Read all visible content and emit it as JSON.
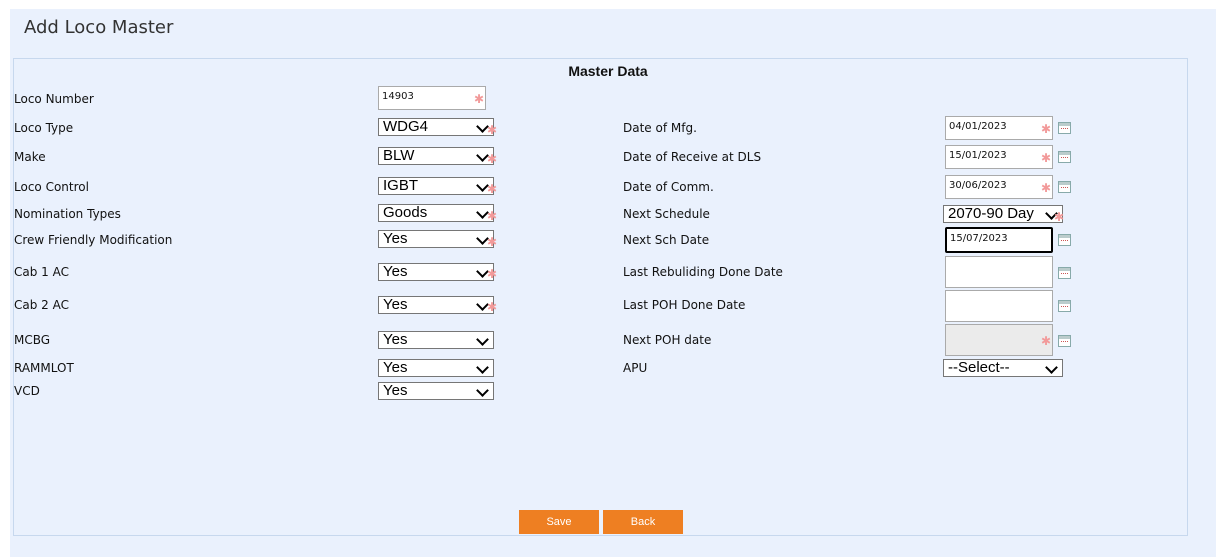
{
  "page": {
    "title": "Add Loco Master"
  },
  "panel": {
    "title": "Master Data"
  },
  "left_fields": [
    {
      "label": "Loco Number",
      "value": "14903",
      "kind": "text",
      "required": true
    },
    {
      "label": "Loco Type",
      "value": "WDG4",
      "kind": "select",
      "required": true
    },
    {
      "label": "Make",
      "value": "BLW",
      "kind": "select",
      "required": true
    },
    {
      "label": "Loco Control",
      "value": "IGBT",
      "kind": "select",
      "required": true
    },
    {
      "label": "Nomination Types",
      "value": "Goods",
      "kind": "select",
      "required": true
    },
    {
      "label": "Crew Friendly Modification",
      "value": "Yes",
      "kind": "select",
      "required": true
    },
    {
      "label": "Cab 1 AC",
      "value": "Yes",
      "kind": "select",
      "required": true
    },
    {
      "label": "Cab 2 AC",
      "value": "Yes",
      "kind": "select",
      "required": true
    },
    {
      "label": "MCBG",
      "value": "Yes",
      "kind": "select",
      "required": false
    },
    {
      "label": "RAMMLOT",
      "value": "Yes",
      "kind": "select",
      "required": false
    },
    {
      "label": "VCD",
      "value": "Yes",
      "kind": "select",
      "required": false
    }
  ],
  "right_fields": [
    {
      "label": "Date of Mfg.",
      "value": "04/01/2023",
      "kind": "date",
      "required": true
    },
    {
      "label": "Date of Receive at DLS",
      "value": "15/01/2023",
      "kind": "date",
      "required": true
    },
    {
      "label": "Date of Comm.",
      "value": "30/06/2023",
      "kind": "date",
      "required": true
    },
    {
      "label": "Next Schedule",
      "value": "2070-90 Day",
      "kind": "select",
      "required": true
    },
    {
      "label": "Next Sch Date",
      "value": "15/07/2023",
      "kind": "date",
      "required": false
    },
    {
      "label": "Last Rebuliding Done Date",
      "value": "",
      "kind": "date",
      "required": false
    },
    {
      "label": "Last POH Done Date",
      "value": "",
      "kind": "date",
      "required": false
    },
    {
      "label": "Next POH date",
      "value": "",
      "kind": "date",
      "required": true
    },
    {
      "label": "APU",
      "value": "--Select--",
      "kind": "select",
      "required": false
    }
  ],
  "buttons": {
    "save": "Save",
    "back": "Back"
  },
  "colors": {
    "accent": "#ee7f22",
    "background": "#eaf1fd",
    "required": "#f29a9a"
  },
  "icons": {
    "date_picker": "calendar-icon",
    "select": "chevron-down-icon",
    "required": "asterisk-icon"
  }
}
